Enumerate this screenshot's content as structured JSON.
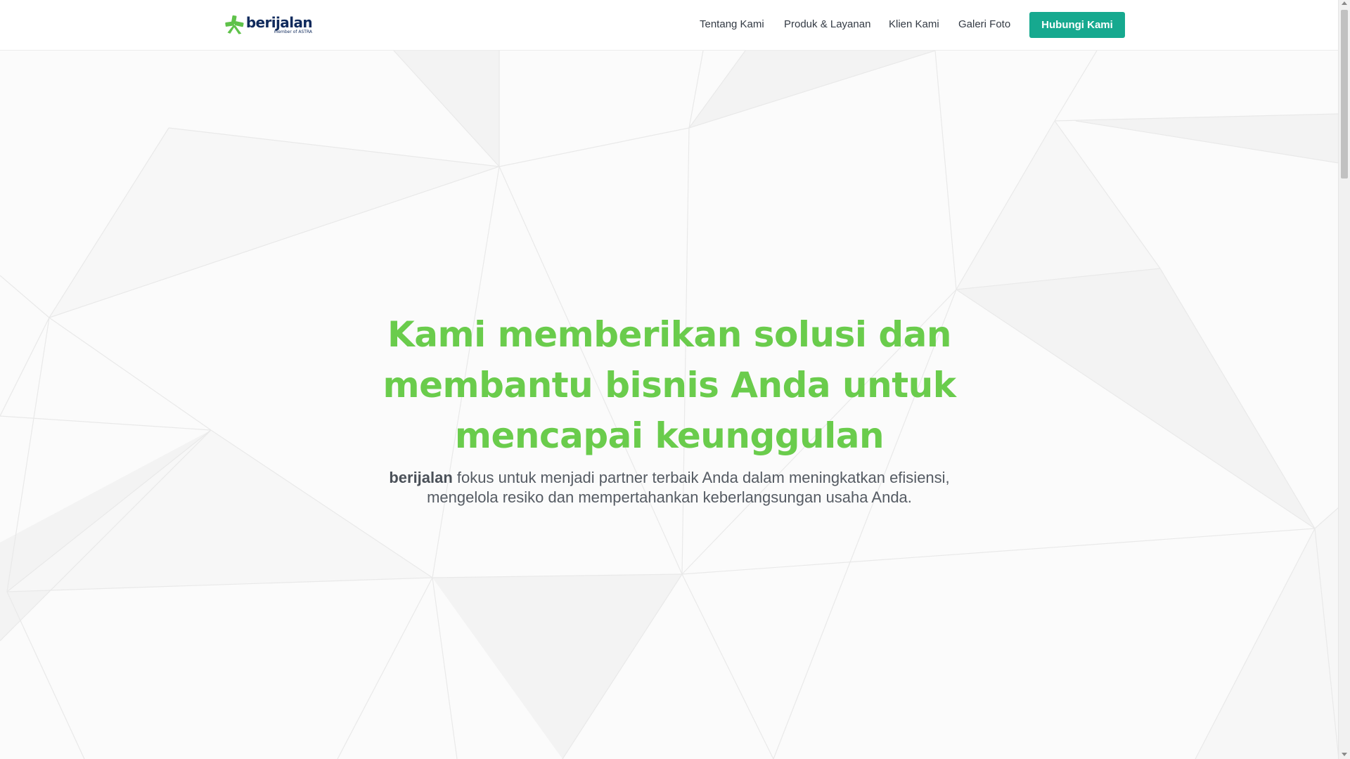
{
  "header": {
    "logo": {
      "wordmark": "berijalan",
      "tagline": "member of ASTRA",
      "icon": "berijalan-logo-icon"
    },
    "nav": {
      "items": [
        {
          "label": "Tentang Kami"
        },
        {
          "label": "Produk & Layanan"
        },
        {
          "label": "Klien Kami"
        },
        {
          "label": "Galeri Foto"
        }
      ],
      "cta_label": "Hubungi Kami"
    }
  },
  "hero": {
    "title": "Kami memberikan solusi dan membantu bisnis Anda untuk mencapai keunggulan",
    "subtitle_brand": "berijalan",
    "subtitle_rest": " fokus untuk menjadi partner terbaik Anda dalam meningkatkan efisiensi, mengelola resiko dan mempertahankan keberlangsungan usaha Anda."
  },
  "colors": {
    "accent_green": "#6acc4c",
    "cta_teal": "#16a98f",
    "brand_navy": "#0f2a5c"
  }
}
